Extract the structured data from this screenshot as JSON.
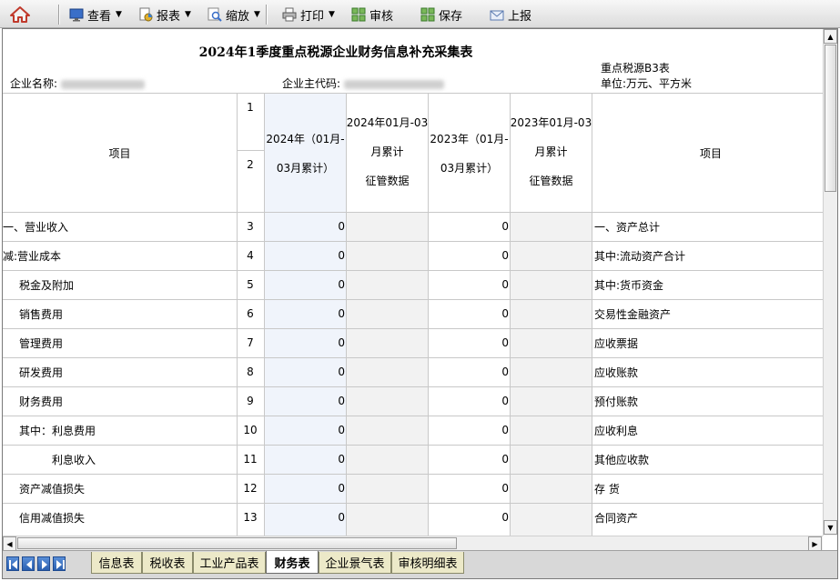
{
  "toolbar": {
    "view_label": "查看",
    "report_label": "报表",
    "zoom_label": "缩放",
    "print_label": "打印",
    "audit_label": "审核",
    "save_label": "保存",
    "submit_label": "上报"
  },
  "report": {
    "title": "2024年1季度重点税源企业财务信息补充采集表",
    "company_name_label": "企业名称:",
    "tax_code_label": "企业主代码:",
    "table_code": "重点税源B3表",
    "unit": "单位:万元、平方米"
  },
  "header": {
    "item_left": "项目",
    "item_right": "项目",
    "row_no_1": "1",
    "row_no_2": "2",
    "col_2024_line1": "2024年（01月-",
    "col_2024_line2": "03月累计）",
    "col_2024_tax_line1": "2024年01月-03",
    "col_2024_tax_line2": "月累计",
    "col_2024_tax_line3": "征管数据",
    "col_2023_line1": "2023年（01月-",
    "col_2023_line2": "03月累计）",
    "col_2023_tax_line1": "2023年01月-03",
    "col_2023_tax_line2": "月累计",
    "col_2023_tax_line3": "征管数据"
  },
  "rows": [
    {
      "left": "一、营业收入",
      "no": "3",
      "v2024": "0",
      "v2023": "0",
      "right": "一、资产总计"
    },
    {
      "left": "减:营业成本",
      "no": "4",
      "v2024": "0",
      "v2023": "0",
      "right": "其中:流动资产合计"
    },
    {
      "left": "税金及附加",
      "no": "5",
      "v2024": "0",
      "v2023": "0",
      "right": "其中:货币资金"
    },
    {
      "left": "销售费用",
      "no": "6",
      "v2024": "0",
      "v2023": "0",
      "right": "交易性金融资产"
    },
    {
      "left": "管理费用",
      "no": "7",
      "v2024": "0",
      "v2023": "0",
      "right": "应收票据"
    },
    {
      "left": "研发费用",
      "no": "8",
      "v2024": "0",
      "v2023": "0",
      "right": "应收账款"
    },
    {
      "left": "财务费用",
      "no": "9",
      "v2024": "0",
      "v2023": "0",
      "right": "预付账款"
    },
    {
      "left": "其中：利息费用",
      "no": "10",
      "v2024": "0",
      "v2023": "0",
      "right": "应收利息"
    },
    {
      "left": "利息收入",
      "no": "11",
      "v2024": "0",
      "v2023": "0",
      "right": "其他应收款"
    },
    {
      "left": "资产减值损失",
      "no": "12",
      "v2024": "0",
      "v2023": "0",
      "right": "存 货"
    },
    {
      "left": "信用减值损失",
      "no": "13",
      "v2024": "0",
      "v2023": "0",
      "right": "合同资产"
    }
  ],
  "tabs": {
    "info": "信息表",
    "tax": "税收表",
    "industrial": "工业产品表",
    "finance": "财务表",
    "prosperity": "企业景气表",
    "audit_detail": "审核明细表"
  }
}
